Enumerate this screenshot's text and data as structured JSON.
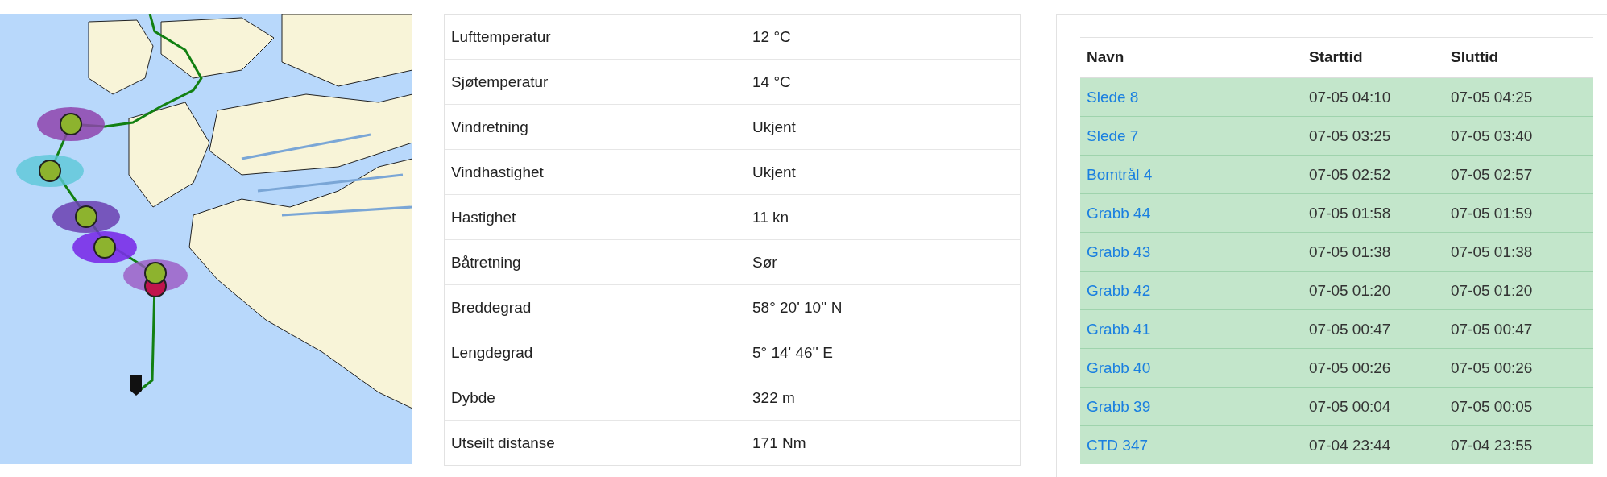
{
  "info": [
    {
      "label": "Lufttemperatur",
      "value": "12 °C"
    },
    {
      "label": "Sjøtemperatur",
      "value": "14 °C"
    },
    {
      "label": "Vindretning",
      "value": "Ukjent"
    },
    {
      "label": "Vindhastighet",
      "value": "Ukjent"
    },
    {
      "label": "Hastighet",
      "value": "11 kn"
    },
    {
      "label": "Båtretning",
      "value": "Sør"
    },
    {
      "label": "Breddegrad",
      "value": "58° 20' 10'' N"
    },
    {
      "label": "Lengdegrad",
      "value": "5° 14' 46'' E"
    },
    {
      "label": "Dybde",
      "value": "322 m"
    },
    {
      "label": "Utseilt distanse",
      "value": "171 Nm"
    }
  ],
  "stations": {
    "columns": [
      "Navn",
      "Starttid",
      "Sluttid"
    ],
    "rows": [
      [
        "Slede 8",
        "07-05 04:10",
        "07-05 04:25"
      ],
      [
        "Slede 7",
        "07-05 03:25",
        "07-05 03:40"
      ],
      [
        "Bomtrål 4",
        "07-05 02:52",
        "07-05 02:57"
      ],
      [
        "Grabb 44",
        "07-05 01:58",
        "07-05 01:59"
      ],
      [
        "Grabb 43",
        "07-05 01:38",
        "07-05 01:38"
      ],
      [
        "Grabb 42",
        "07-05 01:20",
        "07-05 01:20"
      ],
      [
        "Grabb 41",
        "07-05 00:47",
        "07-05 00:47"
      ],
      [
        "Grabb 40",
        "07-05 00:26",
        "07-05 00:26"
      ],
      [
        "Grabb 39",
        "07-05 00:04",
        "07-05 00:05"
      ],
      [
        "CTD 347",
        "07-04 23:44",
        "07-04 23:55"
      ]
    ]
  }
}
